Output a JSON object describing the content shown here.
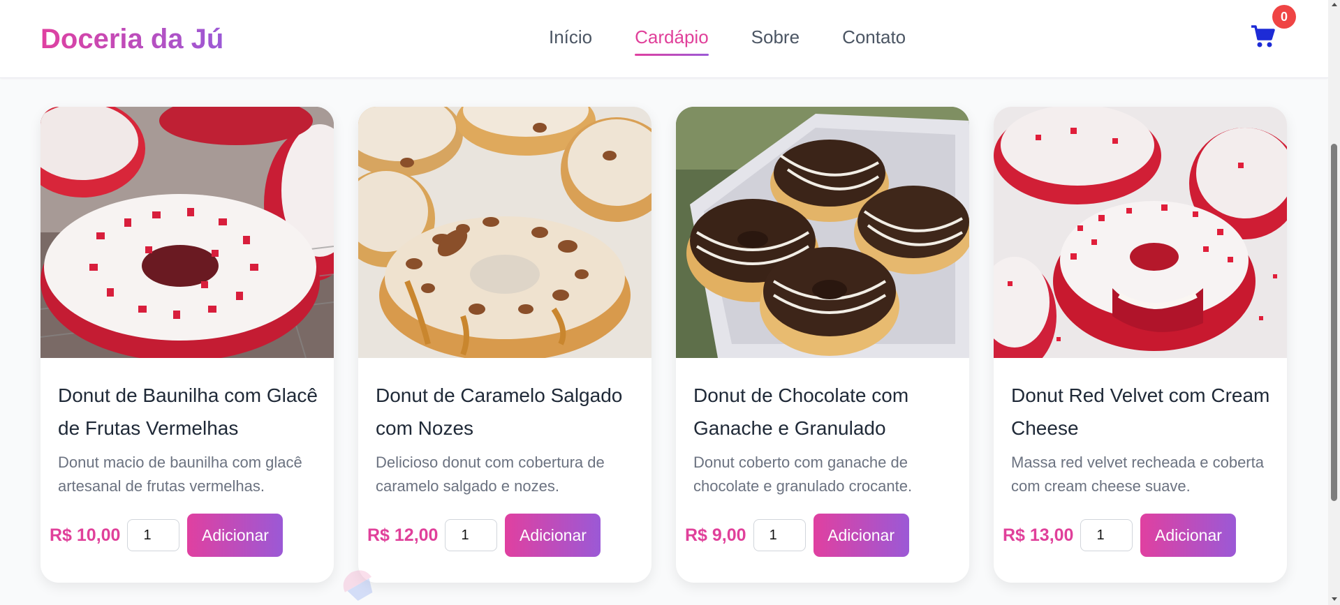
{
  "header": {
    "logo": "Doceria da Jú",
    "nav": [
      {
        "label": "Início",
        "active": false
      },
      {
        "label": "Cardápio",
        "active": true
      },
      {
        "label": "Sobre",
        "active": false
      },
      {
        "label": "Contato",
        "active": false
      }
    ],
    "cart": {
      "icon": "cart-icon",
      "count": "0"
    }
  },
  "products": [
    {
      "title": "Donut de Baunilha com Glacê de Frutas Vermelhas",
      "description": "Donut macio de baunilha com glacê artesanal de frutas vermelhas.",
      "price": "R$ 10,00",
      "quantity": "1",
      "button": "Adicionar"
    },
    {
      "title": "Donut de Caramelo Salgado com Nozes",
      "description": "Delicioso donut com cobertura de caramelo salgado e nozes.",
      "price": "R$ 12,00",
      "quantity": "1",
      "button": "Adicionar"
    },
    {
      "title": "Donut de Chocolate com Ganache e Granulado",
      "description": "Donut coberto com ganache de chocolate e granulado crocante.",
      "price": "R$ 9,00",
      "quantity": "1",
      "button": "Adicionar"
    },
    {
      "title": "Donut Red Velvet com Cream Cheese",
      "description": "Massa red velvet recheada e coberta com cream cheese suave.",
      "price": "R$ 13,00",
      "quantity": "1",
      "button": "Adicionar"
    }
  ],
  "colors": {
    "accent_pink": "#e0409a",
    "accent_purple": "#9b59d6",
    "badge_red": "#ef4444",
    "cart_blue": "#1d2bd6"
  }
}
